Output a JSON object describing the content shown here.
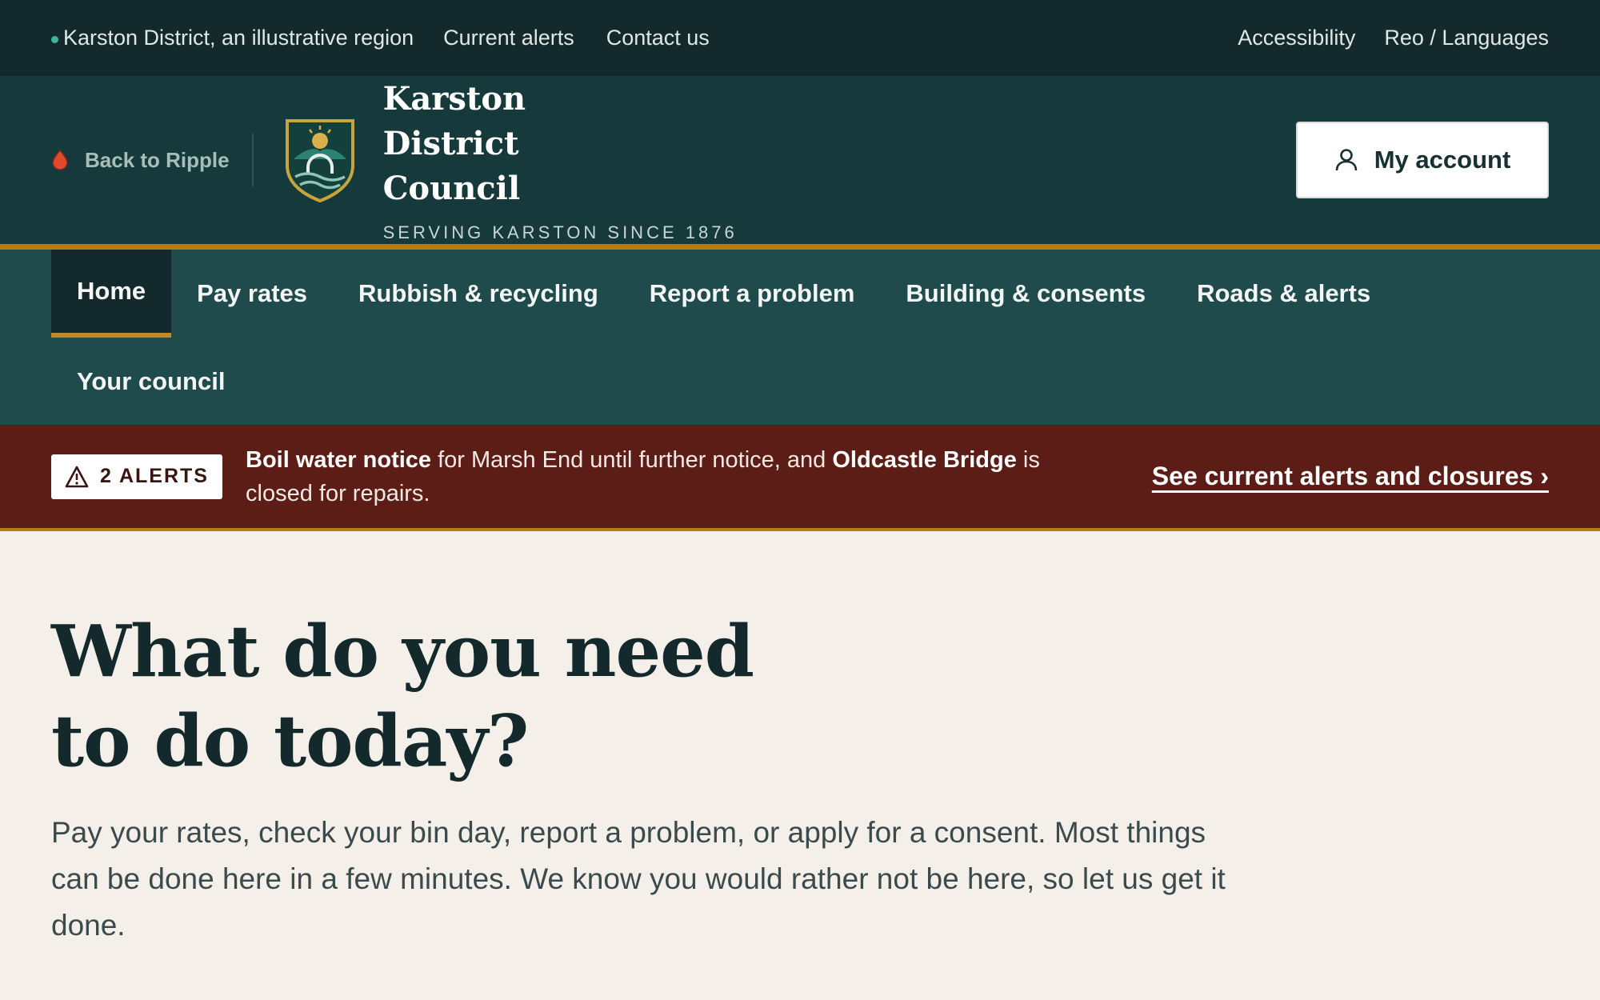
{
  "utility": {
    "region": "Karston District, an illustrative region",
    "links": [
      "Current alerts",
      "Contact us"
    ],
    "right_links": [
      "Accessibility",
      "Reo / Languages"
    ]
  },
  "header": {
    "back_label": "Back to Ripple",
    "council_name": "Karston District Council",
    "tagline": "SERVING KARSTON SINCE 1876",
    "account_label": "My account"
  },
  "nav": {
    "items": [
      "Home",
      "Pay rates",
      "Rubbish & recycling",
      "Report a problem",
      "Building & consents",
      "Roads & alerts"
    ],
    "second_row": "Your council",
    "active": "Home"
  },
  "alert": {
    "badge": "2 ALERTS",
    "bold1": "Boil water notice",
    "text1": " for Marsh End until further notice, and ",
    "bold2": "Oldcastle Bridge",
    "text2": " is closed for repairs.",
    "link": "See current alerts and closures ›"
  },
  "hero": {
    "title": "What do you need to do today?",
    "lede": "Pay your rates, check your bin day, report a problem, or apply for a consent. Most things can be done here in a few minutes. We know you would rather not be here, so let us get it done."
  },
  "colors": {
    "utility_bg": "#14292b",
    "header_bg": "#163a3b",
    "nav_bg": "#1f4b4c",
    "accent_gold": "#b67a17",
    "alert_bg": "#5b1d15",
    "page_bg": "#f4f0e9"
  }
}
